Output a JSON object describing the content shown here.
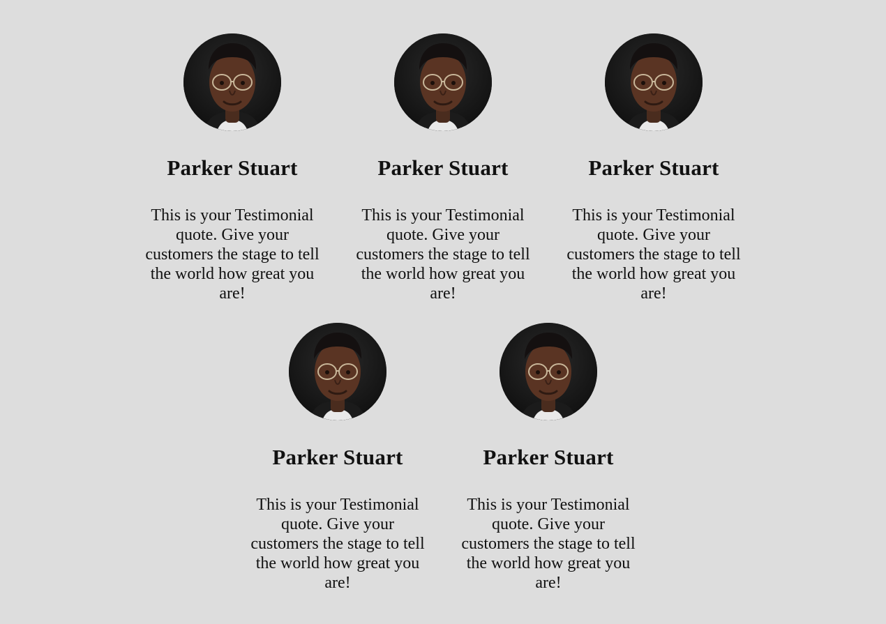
{
  "testimonials": [
    {
      "name": "Parker Stuart",
      "quote": "This is your Testimonial quote. Give your customers the stage to tell the world how great you are!",
      "avatar_icon": "person-avatar-portrait"
    },
    {
      "name": "Parker Stuart",
      "quote": "This is your Testimonial quote. Give your customers the stage to tell the world how great you are!",
      "avatar_icon": "person-avatar-portrait"
    },
    {
      "name": "Parker Stuart",
      "quote": "This is your Testimonial quote. Give your customers the stage to tell the world how great you are!",
      "avatar_icon": "person-avatar-portrait"
    },
    {
      "name": "Parker Stuart",
      "quote": "This is your Testimonial quote. Give your customers the stage to tell the world how great you are!",
      "avatar_icon": "person-avatar-portrait"
    },
    {
      "name": "Parker Stuart",
      "quote": "This is your Testimonial quote. Give your customers the stage to tell the world how great you are!",
      "avatar_icon": "person-avatar-portrait"
    }
  ],
  "colors": {
    "background": "#dddddd",
    "text": "#111111"
  }
}
